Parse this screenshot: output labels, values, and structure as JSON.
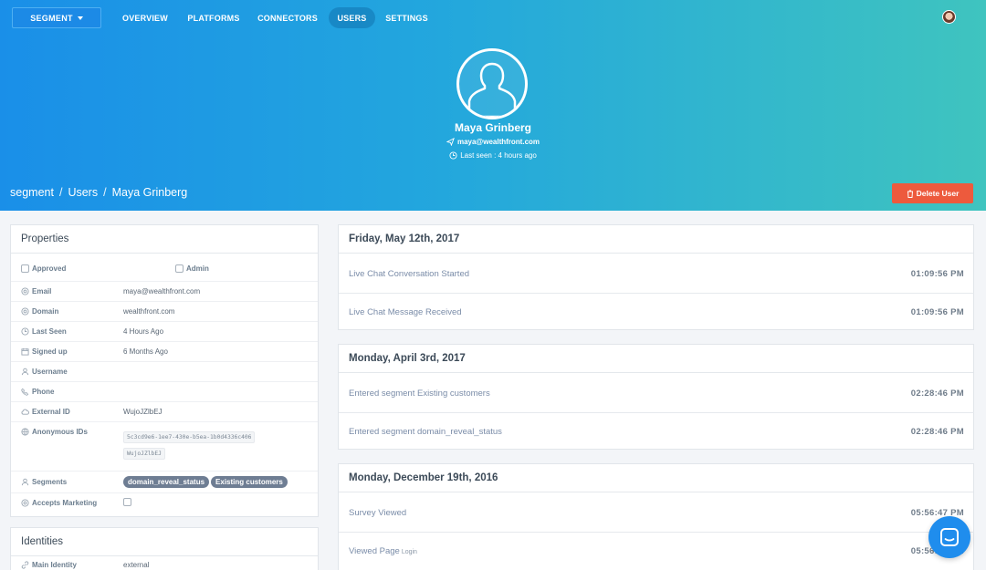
{
  "nav": {
    "workspace": "SEGMENT",
    "items": [
      "OVERVIEW",
      "PLATFORMS",
      "CONNECTORS",
      "USERS",
      "SETTINGS"
    ],
    "active": "USERS"
  },
  "user": {
    "name": "Maya Grinberg",
    "email": "maya@wealthfront.com",
    "last_seen": "Last seen : 4 hours ago"
  },
  "breadcrumb": [
    "segment",
    "Users",
    "Maya Grinberg"
  ],
  "delete_label": "Delete User",
  "properties": {
    "title": "Properties",
    "approved_label": "Approved",
    "admin_label": "Admin",
    "rows": [
      {
        "label": "Email",
        "value": "maya@wealthfront.com",
        "icon": "at-icon"
      },
      {
        "label": "Domain",
        "value": "wealthfront.com",
        "icon": "at-icon"
      },
      {
        "label": "Last Seen",
        "value": "4 Hours Ago",
        "icon": "clock-icon"
      },
      {
        "label": "Signed up",
        "value": "6 Months Ago",
        "icon": "calendar-icon"
      },
      {
        "label": "Username",
        "value": "",
        "icon": "user-icon"
      },
      {
        "label": "Phone",
        "value": "",
        "icon": "phone-icon"
      },
      {
        "label": "External ID",
        "value": "WujoJZlbEJ",
        "icon": "cloud-icon"
      }
    ],
    "anonymous_label": "Anonymous IDs",
    "anonymous_ids": [
      "5c3cd9e6-1ee7-430e-b5ea-1b0d4336c406",
      "WujoJZlbEJ"
    ],
    "segments_label": "Segments",
    "segments": [
      "domain_reveal_status",
      "Existing customers"
    ],
    "marketing_label": "Accepts Marketing"
  },
  "identities": {
    "title": "Identities",
    "main_label": "Main Identity",
    "main_value": "external"
  },
  "events": [
    {
      "date": "Friday, May 12th, 2017",
      "items": [
        {
          "name": "Live Chat Conversation Started",
          "sub": "",
          "time": "01:09:56 PM"
        },
        {
          "name": "Live Chat Message Received",
          "sub": "",
          "time": "01:09:56 PM"
        }
      ]
    },
    {
      "date": "Monday, April 3rd, 2017",
      "items": [
        {
          "name": "Entered segment Existing customers",
          "sub": "",
          "time": "02:28:46 PM"
        },
        {
          "name": "Entered segment domain_reveal_status",
          "sub": "",
          "time": "02:28:46 PM"
        }
      ]
    },
    {
      "date": "Monday, December 19th, 2016",
      "items": [
        {
          "name": "Survey Viewed",
          "sub": "",
          "time": "05:56:47 PM"
        },
        {
          "name": "Viewed Page",
          "sub": "Login",
          "time": "05:56:47 PM"
        }
      ]
    }
  ]
}
